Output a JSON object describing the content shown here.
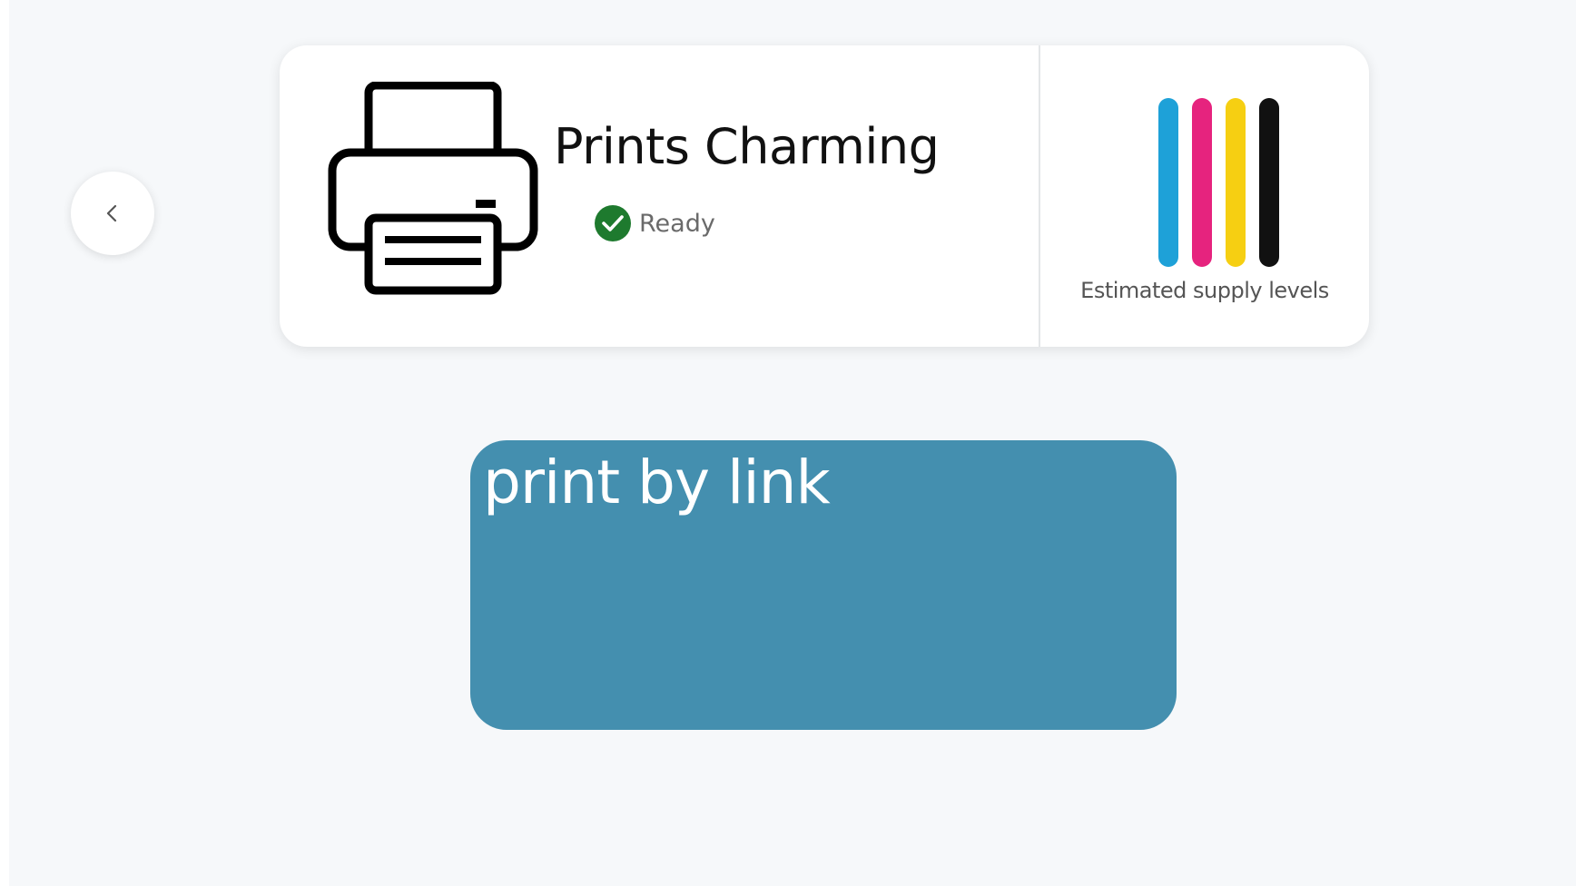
{
  "navigation": {
    "back_icon": "chevron-left-icon"
  },
  "printer": {
    "icon": "printer-icon",
    "name": "Prints Charming",
    "status": {
      "icon": "check-circle-icon",
      "label": "Ready",
      "color": "#1e7a2e"
    }
  },
  "supplies": {
    "label": "Estimated supply levels",
    "inks": [
      {
        "name": "cyan",
        "color": "#1ea1d8"
      },
      {
        "name": "magenta",
        "color": "#e6237e"
      },
      {
        "name": "yellow",
        "color": "#f6cf12"
      },
      {
        "name": "black",
        "color": "#111111"
      }
    ]
  },
  "actions": {
    "print_by_link": {
      "label": "print by link",
      "color": "#448faf"
    }
  }
}
